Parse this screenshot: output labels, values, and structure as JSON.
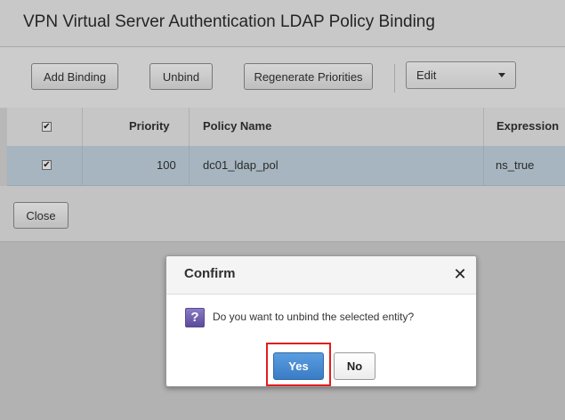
{
  "page": {
    "title": "VPN Virtual Server Authentication LDAP Policy Binding"
  },
  "toolbar": {
    "add_binding": "Add Binding",
    "unbind": "Unbind",
    "regenerate": "Regenerate Priorities",
    "edit_select": {
      "selected": "Edit",
      "icon": "chevron-down-icon"
    }
  },
  "table": {
    "header_checkbox": "✔",
    "columns": [
      "Priority",
      "Policy Name",
      "Expression"
    ],
    "rows": [
      {
        "checked": "✔",
        "priority": "100",
        "policy_name": "dc01_ldap_pol",
        "expression": "ns_true"
      }
    ]
  },
  "footer": {
    "close": "Close"
  },
  "dialog": {
    "title": "Confirm",
    "close_glyph": "✕",
    "icon": "question-icon",
    "icon_glyph": "?",
    "message": "Do you want to unbind the selected entity?",
    "yes": "Yes",
    "no": "No"
  },
  "colors": {
    "selected_row": "#c6d8e4",
    "primary_button": "#3a7cc4",
    "highlight": "#e01e1e"
  }
}
